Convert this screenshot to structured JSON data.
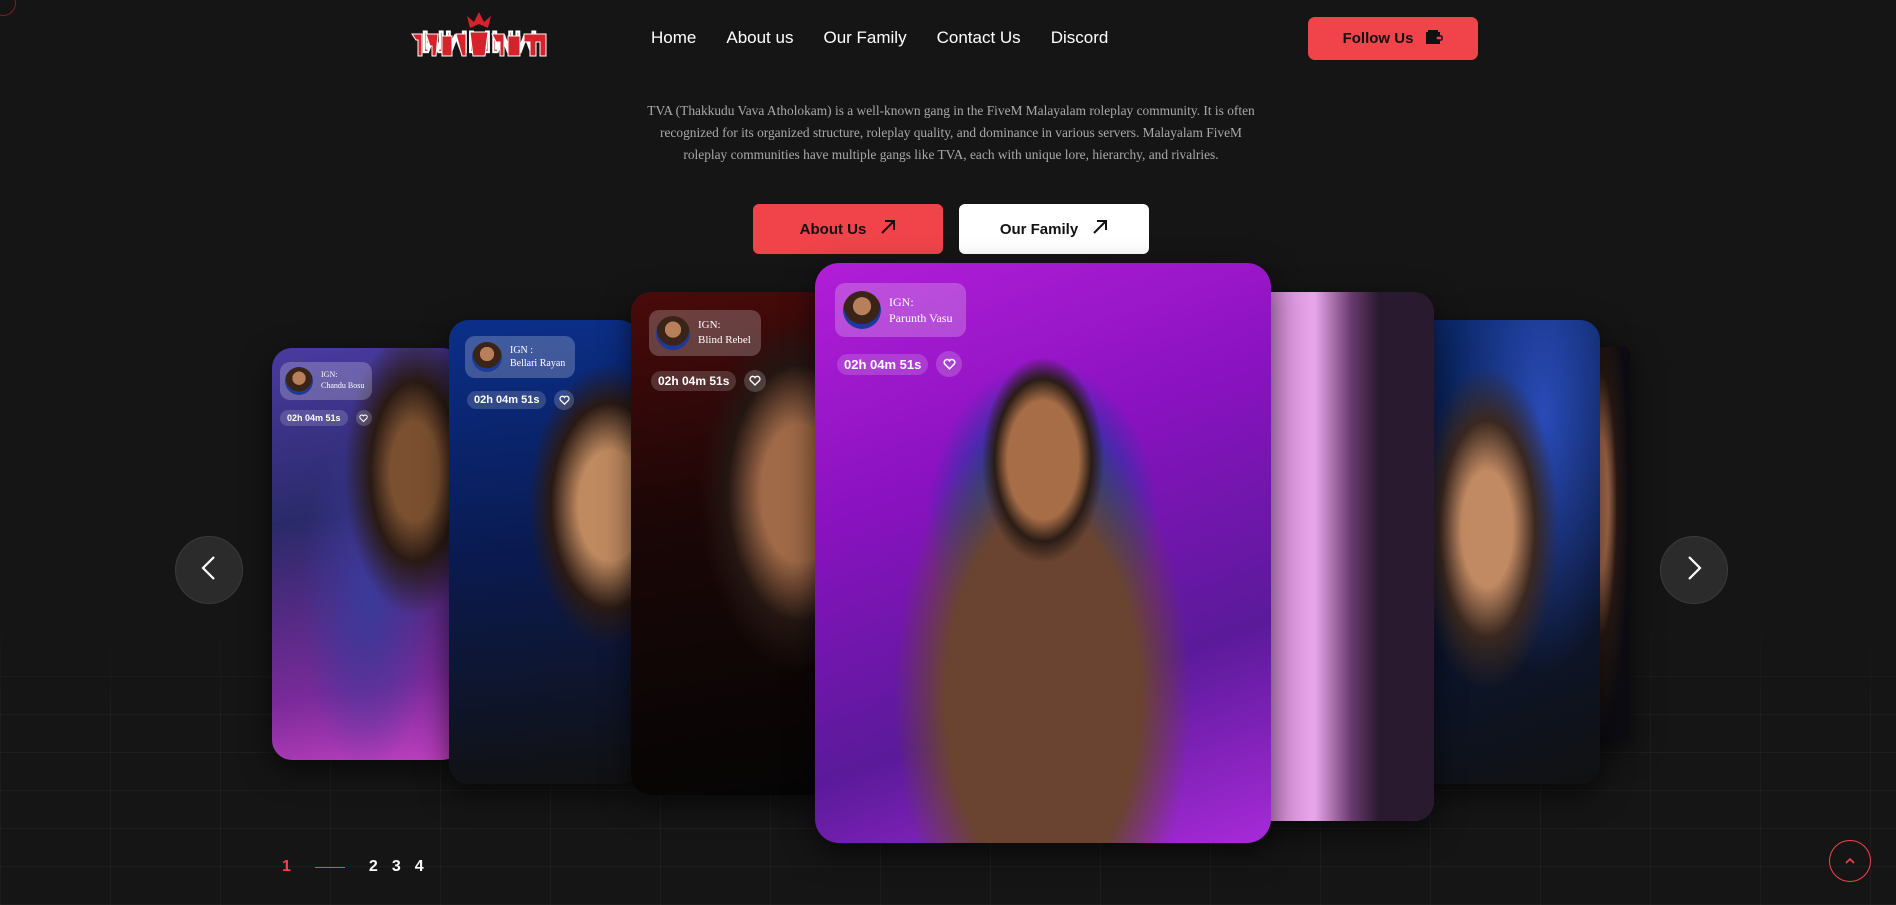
{
  "header": {
    "logo_text": "THAKKUDU",
    "nav": [
      "Home",
      "About us",
      "Our Family",
      "Contact Us",
      "Discord"
    ],
    "follow_label": "Follow Us"
  },
  "intro": "TVA (Thakkudu Vava Atholokam) is a well-known gang in the FiveM Malayalam roleplay community. It is often recognized for its organized structure, roleplay quality, and dominance in various servers. Malayalam FiveM roleplay communities have multiple gangs like TVA, each with unique lore, hierarchy, and rivalries.",
  "cta": {
    "about_label": "About Us",
    "family_label": "Our Family"
  },
  "cards": [
    {
      "ign_label": "IGN:",
      "name": "Chandu Bosu",
      "timer": "02h 04m 51s"
    },
    {
      "ign_label": "IGN :",
      "name": "Bellari Rayan",
      "timer": "02h 04m 51s"
    },
    {
      "ign_label": "IGN:",
      "name": "Blind Rebel",
      "timer": "02h 04m 51s"
    },
    {
      "ign_label": "IGN:",
      "name": "Parunth Vasu",
      "timer": "02h 04m 51s"
    }
  ],
  "pager": {
    "pages": [
      "1",
      "2",
      "3",
      "4"
    ],
    "active": "1"
  },
  "colors": {
    "accent": "#f0444a",
    "background": "#151515"
  }
}
